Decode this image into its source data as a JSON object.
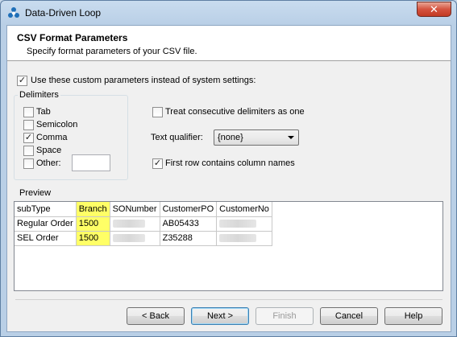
{
  "window": {
    "title": "Data-Driven Loop",
    "close_label": "✕"
  },
  "header": {
    "title": "CSV Format Parameters",
    "subtitle": "Specify format parameters of your CSV file."
  },
  "use_custom": {
    "label": "Use these custom parameters instead of system settings:",
    "checked": true
  },
  "delimiters": {
    "legend": "Delimiters",
    "items": [
      {
        "label": "Tab",
        "checked": false
      },
      {
        "label": "Semicolon",
        "checked": false
      },
      {
        "label": "Comma",
        "checked": true
      },
      {
        "label": "Space",
        "checked": false
      },
      {
        "label": "Other:",
        "checked": false
      }
    ],
    "other_value": ""
  },
  "options": {
    "treat_consecutive": {
      "label": "Treat consecutive delimiters as one",
      "checked": false
    },
    "text_qualifier_label": "Text qualifier:",
    "text_qualifier_value": "{none}",
    "first_row": {
      "label": "First row contains column names",
      "checked": true
    }
  },
  "preview": {
    "legend": "Preview",
    "columns": [
      "subType",
      "Branch",
      "SONumber",
      "CustomerPO",
      "CustomerNo"
    ],
    "rows": [
      [
        "Regular Order",
        "1500",
        "",
        "AB05433",
        ""
      ],
      [
        "SEL Order",
        "1500",
        "",
        "Z35288",
        ""
      ]
    ],
    "highlight_color": "#ffff66"
  },
  "buttons": {
    "back": "< Back",
    "next": "Next >",
    "finish": "Finish",
    "cancel": "Cancel",
    "help": "Help"
  }
}
